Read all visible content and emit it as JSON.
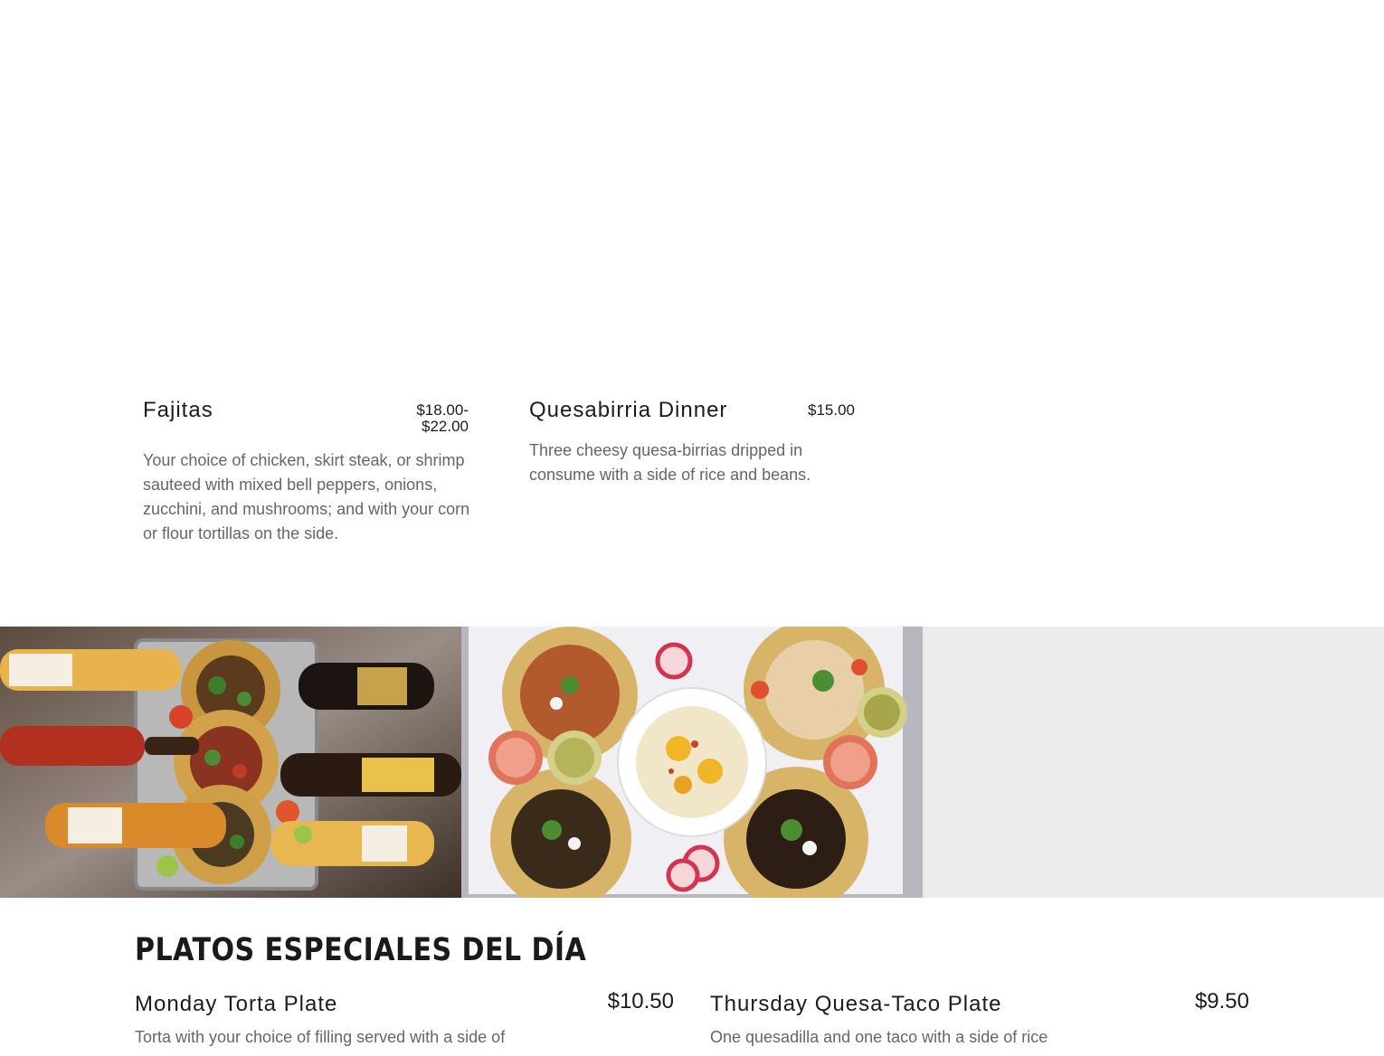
{
  "menu_items": [
    {
      "name": "Fajitas",
      "price_line1": "$18.00-",
      "price_line2": "$22.00",
      "description": "Your choice of chicken, skirt steak, or shrimp sauteed with mixed bell peppers, onions, zucchini, and mushrooms; and with your corn or flour tortillas on the side."
    },
    {
      "name": "Quesabirria Dinner",
      "price": "$15.00",
      "description": "Three cheesy quesa-birrias dripped in consume with a side of rice and beans."
    }
  ],
  "gallery": {
    "photo_1": "tacos-with-beers-photo",
    "photo_2": "tacos-with-elote-photo",
    "photo_3": "empty-placeholder"
  },
  "specials": {
    "title": "PLATOS ESPECIALES DEL DÍA",
    "items": [
      {
        "name": "Monday Torta Plate",
        "price": "$10.50",
        "description": "Torta with your choice of filling served with a side of"
      },
      {
        "name": "Thursday Quesa-Taco Plate",
        "price": "$9.50",
        "description": "One quesadilla and one taco with a side of rice"
      }
    ]
  }
}
